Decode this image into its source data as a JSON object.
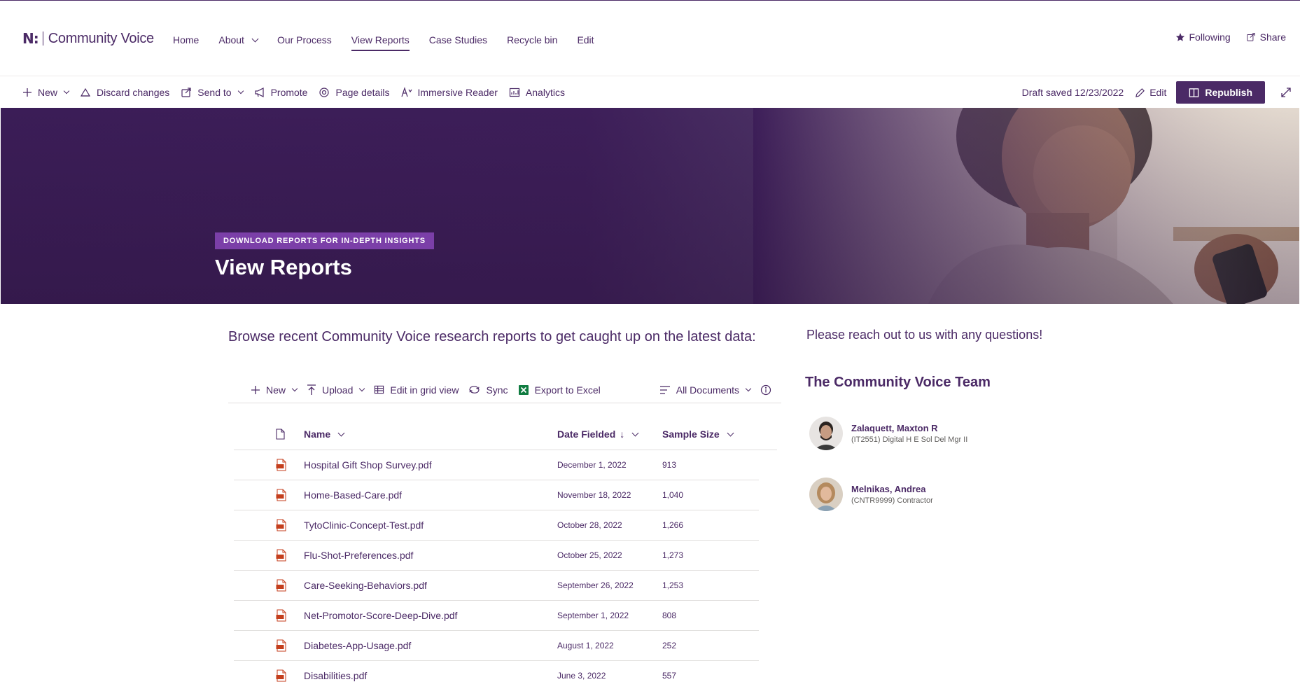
{
  "site": {
    "logo_mark": "N:",
    "name": "Community Voice",
    "nav": [
      {
        "label": "Home"
      },
      {
        "label": "About"
      },
      {
        "label": "Our Process"
      },
      {
        "label": "View Reports"
      },
      {
        "label": "Case Studies"
      },
      {
        "label": "Recycle bin"
      },
      {
        "label": "Edit"
      }
    ],
    "following_label": "Following",
    "share_label": "Share"
  },
  "commandbar": {
    "new_label": "New",
    "discard_label": "Discard changes",
    "sendto_label": "Send to",
    "promote_label": "Promote",
    "page_details_label": "Page details",
    "immersive_label": "Immersive Reader",
    "analytics_label": "Analytics",
    "draft_status": "Draft saved 12/23/2022",
    "edit_label": "Edit",
    "republish_label": "Republish"
  },
  "hero": {
    "tag": "DOWNLOAD REPORTS FOR IN-DEPTH INSIGHTS",
    "title": "View Reports"
  },
  "intro": "Browse recent Community Voice research reports to get caught up on the latest data:",
  "library": {
    "toolbar": {
      "new_label": "New",
      "upload_label": "Upload",
      "grid_label": "Edit in grid view",
      "sync_label": "Sync",
      "excel_label": "Export to Excel",
      "view_label": "All Documents"
    },
    "columns": {
      "name": "Name",
      "date": "Date Fielded",
      "size": "Sample Size"
    },
    "rows": [
      {
        "name": "Hospital Gift Shop Survey.pdf",
        "date": "December 1, 2022",
        "size": "913"
      },
      {
        "name": "Home-Based-Care.pdf",
        "date": "November 18, 2022",
        "size": "1,040"
      },
      {
        "name": "TytoClinic-Concept-Test.pdf",
        "date": "October 28, 2022",
        "size": "1,266"
      },
      {
        "name": "Flu-Shot-Preferences.pdf",
        "date": "October 25, 2022",
        "size": "1,273"
      },
      {
        "name": "Care-Seeking-Behaviors.pdf",
        "date": "September 26, 2022",
        "size": "1,253"
      },
      {
        "name": "Net-Promotor-Score-Deep-Dive.pdf",
        "date": "September 1, 2022",
        "size": "808"
      },
      {
        "name": "Diabetes-App-Usage.pdf",
        "date": "August 1, 2022",
        "size": "252"
      },
      {
        "name": "Disabilities.pdf",
        "date": "June 3, 2022",
        "size": "557"
      }
    ]
  },
  "contact": {
    "reach_text": "Please reach out to us with any questions!",
    "team_title": "The Community Voice Team",
    "people": [
      {
        "name": "Zalaquett, Maxton R",
        "title": "(IT2551) Digital H E Sol Del Mgr II"
      },
      {
        "name": "Melnikas, Andrea",
        "title": "(CNTR9999) Contractor"
      }
    ]
  },
  "colors": {
    "brand": "#4b2a66",
    "tag": "#7b3fa8",
    "pdf_red": "#c43e1c"
  }
}
